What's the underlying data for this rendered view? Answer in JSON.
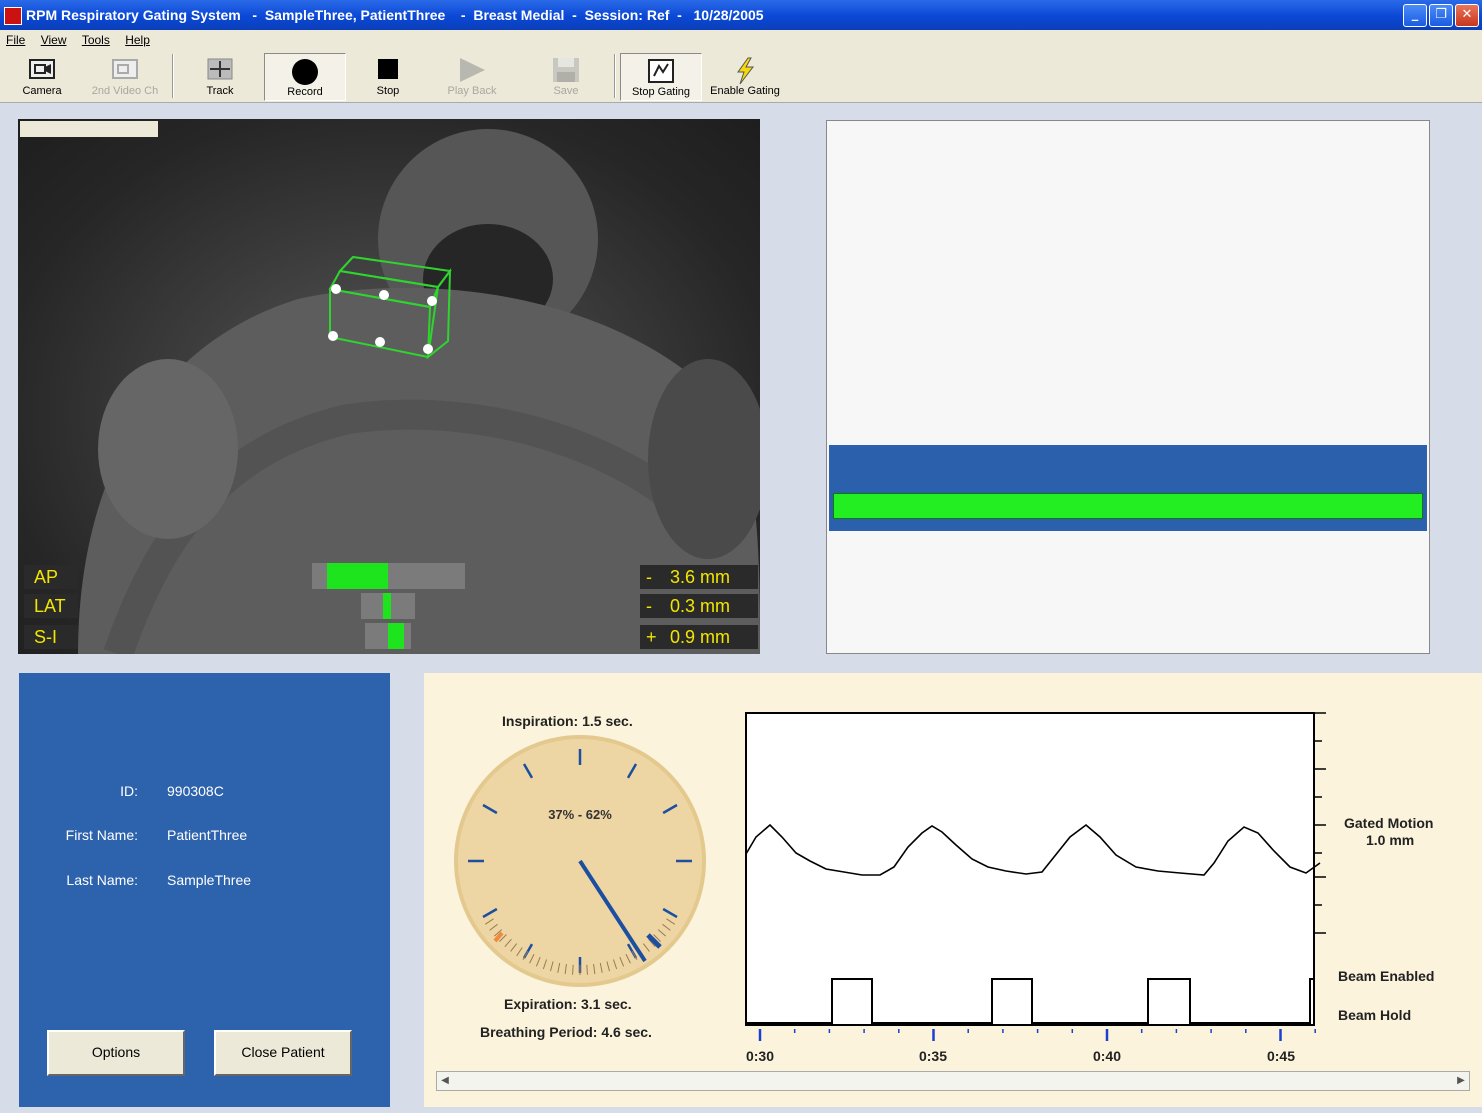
{
  "window": {
    "title": "RPM Respiratory Gating System   -  SampleThree, PatientThree    -  Breast Medial  -  Session: Ref  -   10/28/2005",
    "minimize": "_",
    "restore": "❐",
    "close": "✕"
  },
  "menu": [
    "File",
    "View",
    "Tools",
    "Help"
  ],
  "toolbar": {
    "camera": "Camera",
    "second_video": "2nd Video Ch",
    "track": "Track",
    "record": "Record",
    "stop": "Stop",
    "play_back": "Play Back",
    "save": "Save",
    "stop_gating": "Stop Gating",
    "enable_gating": "Enable Gating"
  },
  "readouts": [
    {
      "label": "AP",
      "sign": "-",
      "value": "3.6 mm",
      "meter_start": 0.1,
      "meter_end": 0.5
    },
    {
      "label": "LAT",
      "sign": "-",
      "value": "0.3 mm",
      "meter_start": 0.4,
      "meter_end": 0.55
    },
    {
      "label": "S-I",
      "sign": "+",
      "value": "0.9 mm",
      "meter_start": 0.5,
      "meter_end": 0.85
    }
  ],
  "patient": {
    "id_label": "ID:",
    "id": "990308C",
    "first_name_label": "First Name:",
    "first_name": "PatientThree",
    "last_name_label": "Last Name:",
    "last_name": "SampleThree",
    "options": "Options",
    "close_patient": "Close Patient"
  },
  "breathing": {
    "inspiration": "Inspiration: 1.5 sec.",
    "phase_window": "37% - 62%",
    "expiration": "Expiration: 3.1 sec.",
    "period": "Breathing Period: 4.6 sec.",
    "gated_motion": "Gated Motion",
    "gated_motion_value": "1.0 mm",
    "beam_enabled": "Beam Enabled",
    "beam_hold": "Beam Hold",
    "time_ticks": [
      "0:30",
      "0:35",
      "0:40",
      "0:45"
    ]
  },
  "colors": {
    "accent_blue": "#2d62ad",
    "gating_green": "#22ee22",
    "readout_yellow": "#f2e600",
    "dial_needle": "#1c4fa0"
  }
}
